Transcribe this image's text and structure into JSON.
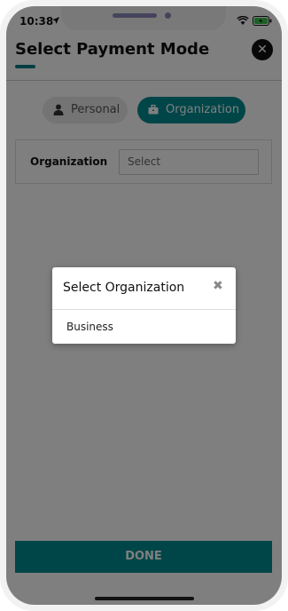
{
  "status_bar": {
    "time": "10:38",
    "icons": [
      "location-arrow-icon",
      "wifi-icon",
      "battery-charging-icon"
    ]
  },
  "header": {
    "title": "Select Payment Mode",
    "close_icon": "close-icon"
  },
  "tabs": [
    {
      "label": "Personal",
      "icon": "user-icon",
      "active": false
    },
    {
      "label": "Organization",
      "icon": "briefcase-icon",
      "active": true
    }
  ],
  "form": {
    "organization_label": "Organization",
    "organization_placeholder": "Select"
  },
  "footer": {
    "done_label": "DONE"
  },
  "modal": {
    "title": "Select Organization",
    "close_icon": "close-x-icon",
    "options": [
      "Business"
    ]
  },
  "colors": {
    "accent": "#008c92",
    "overlay": "#000000",
    "tab_inactive": "#e9e9e9"
  }
}
